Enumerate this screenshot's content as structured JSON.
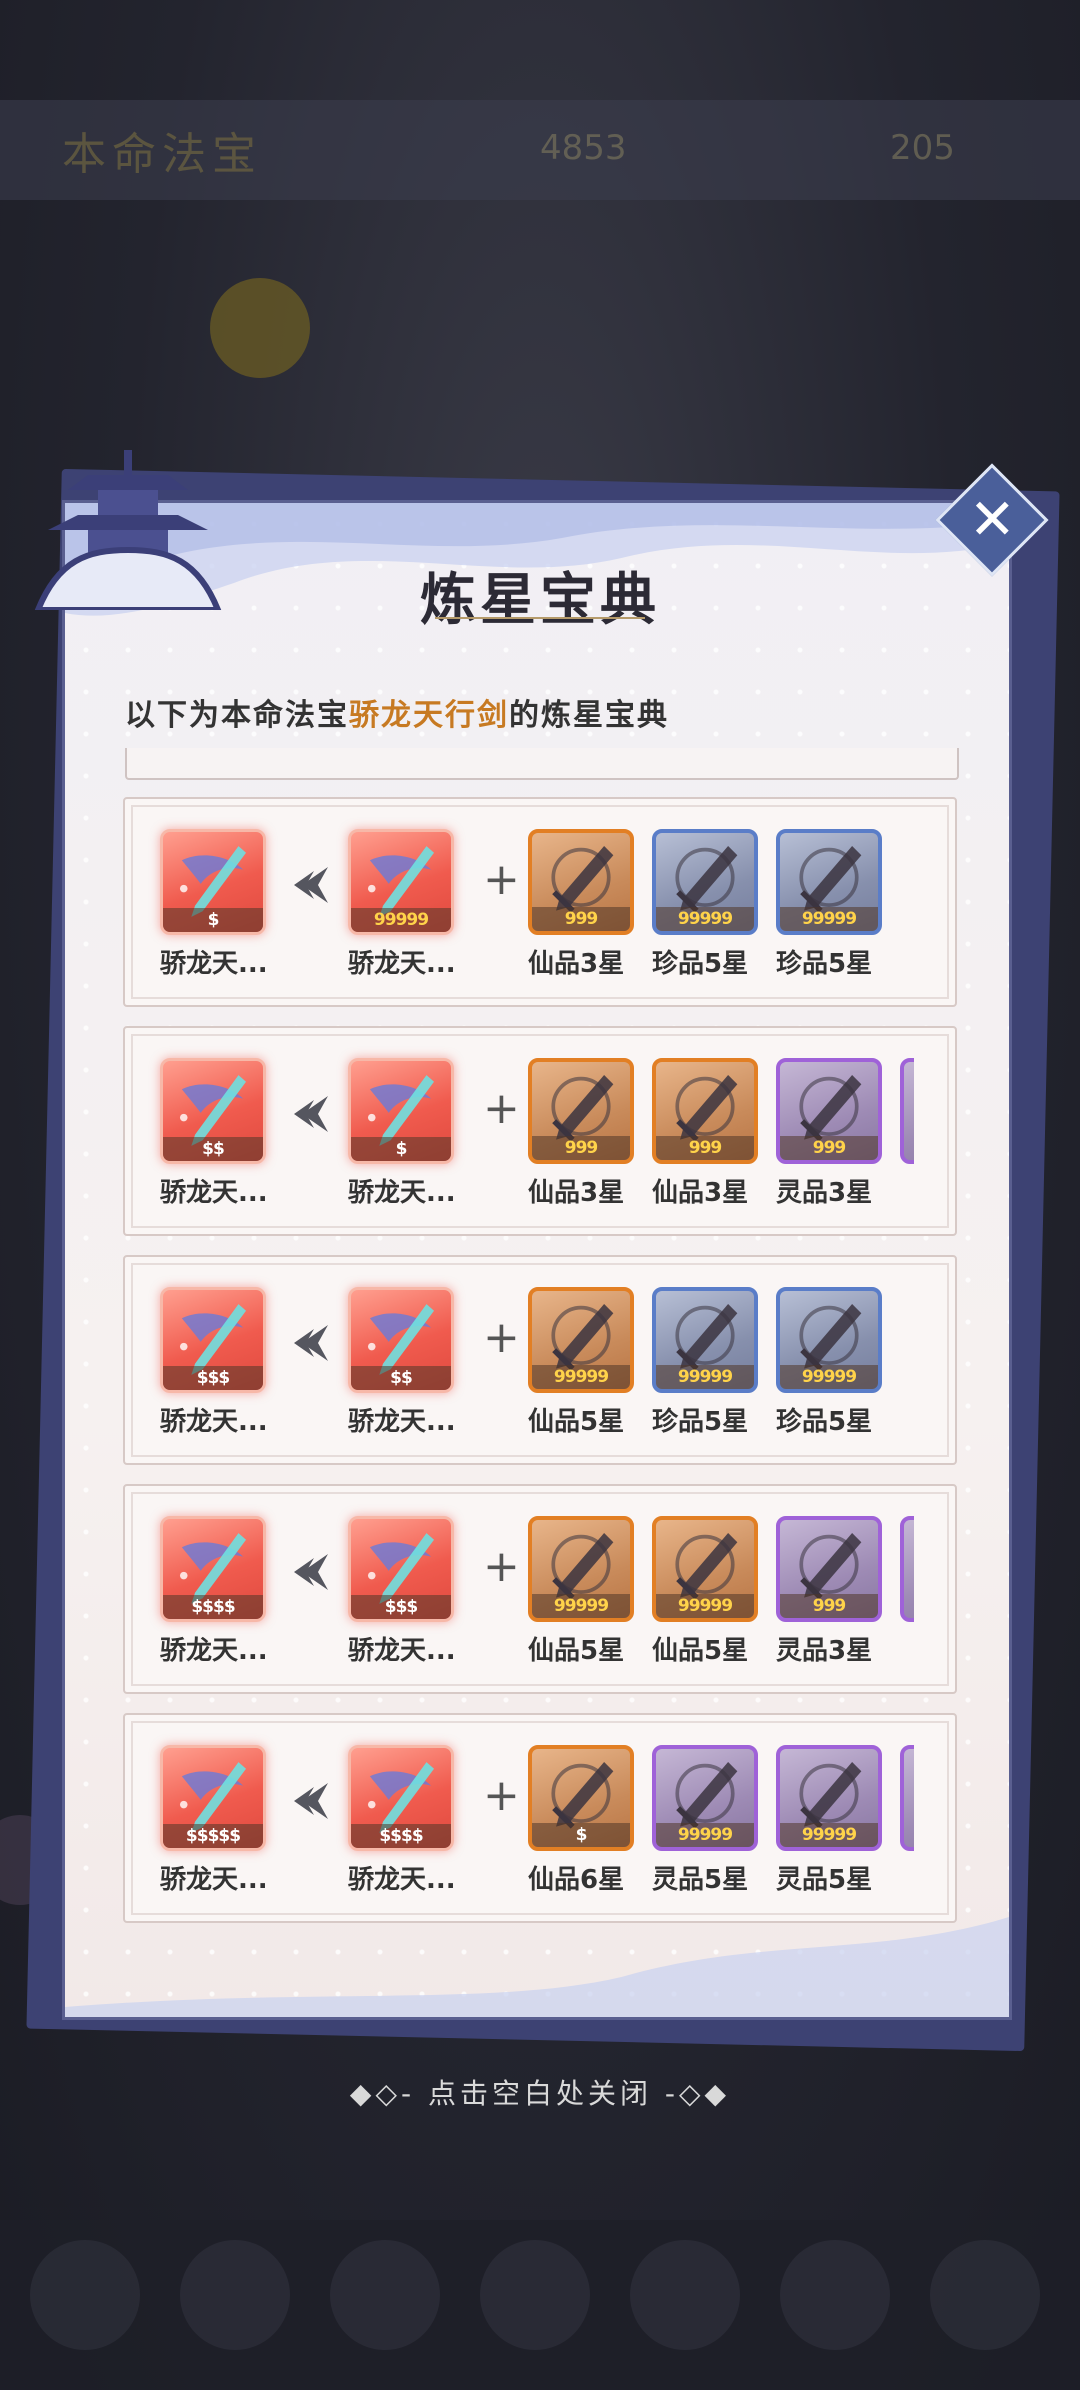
{
  "background": {
    "title": "本命法宝",
    "res1": "4853",
    "res2": "205"
  },
  "modal": {
    "title": "炼星宝典",
    "close_label": "✕",
    "subtitle_prefix": "以下为本命法宝",
    "subtitle_highlight": "骄龙天行剑",
    "subtitle_suffix": "的炼星宝典",
    "hint": "◆◇- 点击空白处关闭 -◇◆"
  },
  "rows": [
    {
      "result": {
        "label": "骄龙天...",
        "stars": "$",
        "rarity": "red"
      },
      "base": {
        "label": "骄龙天...",
        "stars": "99999",
        "rarity": "red"
      },
      "materials": [
        {
          "label": "仙品3星",
          "stars": "999",
          "rarity": "orange"
        },
        {
          "label": "珍品5星",
          "stars": "99999",
          "rarity": "blue"
        },
        {
          "label": "珍品5星",
          "stars": "99999",
          "rarity": "blue"
        }
      ]
    },
    {
      "result": {
        "label": "骄龙天...",
        "stars": "$$",
        "rarity": "red"
      },
      "base": {
        "label": "骄龙天...",
        "stars": "$",
        "rarity": "red"
      },
      "materials": [
        {
          "label": "仙品3星",
          "stars": "999",
          "rarity": "orange"
        },
        {
          "label": "仙品3星",
          "stars": "999",
          "rarity": "orange"
        },
        {
          "label": "灵品3星",
          "stars": "999",
          "rarity": "purple"
        }
      ]
    },
    {
      "result": {
        "label": "骄龙天...",
        "stars": "$$$",
        "rarity": "red"
      },
      "base": {
        "label": "骄龙天...",
        "stars": "$$",
        "rarity": "red"
      },
      "materials": [
        {
          "label": "仙品5星",
          "stars": "99999",
          "rarity": "orange"
        },
        {
          "label": "珍品5星",
          "stars": "99999",
          "rarity": "blue"
        },
        {
          "label": "珍品5星",
          "stars": "99999",
          "rarity": "blue"
        }
      ]
    },
    {
      "result": {
        "label": "骄龙天...",
        "stars": "$$$$",
        "rarity": "red"
      },
      "base": {
        "label": "骄龙天...",
        "stars": "$$$",
        "rarity": "red"
      },
      "materials": [
        {
          "label": "仙品5星",
          "stars": "99999",
          "rarity": "orange"
        },
        {
          "label": "仙品5星",
          "stars": "99999",
          "rarity": "orange"
        },
        {
          "label": "灵品3星",
          "stars": "999",
          "rarity": "purple"
        }
      ]
    },
    {
      "result": {
        "label": "骄龙天...",
        "stars": "$$$$$",
        "rarity": "red"
      },
      "base": {
        "label": "骄龙天...",
        "stars": "$$$$",
        "rarity": "red"
      },
      "materials": [
        {
          "label": "仙品6星",
          "stars": "$",
          "rarity": "orange"
        },
        {
          "label": "灵品5星",
          "stars": "99999",
          "rarity": "purple"
        },
        {
          "label": "灵品5星",
          "stars": "99999",
          "rarity": "purple"
        }
      ]
    }
  ],
  "colors": {
    "accent_highlight": "#c77a22",
    "rarity_orange": "#e27f24",
    "rarity_blue": "#5a7dc8",
    "rarity_purple": "#9f62d8",
    "rarity_red": "#f05b4e"
  },
  "icons": {
    "close": "close-icon",
    "arrow": "left-chevron-arrow-icon",
    "plus": "plus-icon",
    "item": "sword-icon"
  }
}
